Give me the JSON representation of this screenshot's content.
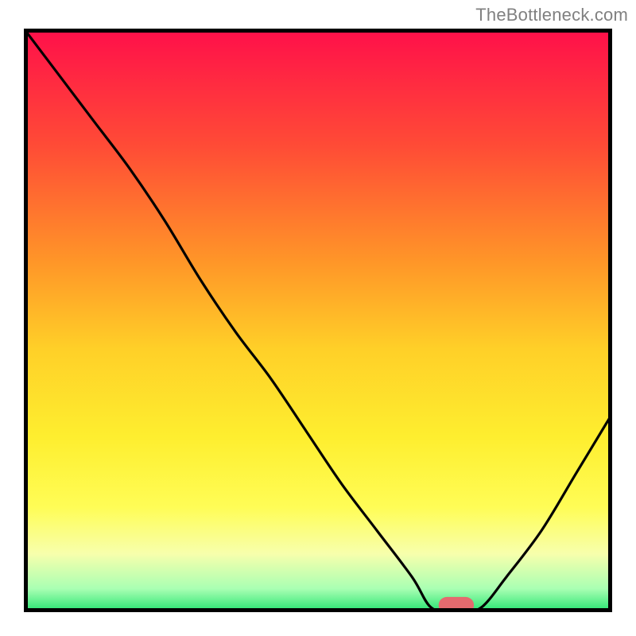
{
  "watermark": "TheBottleneck.com",
  "chart_data": {
    "type": "line",
    "title": "",
    "xlabel": "",
    "ylabel": "",
    "xlim": [
      0,
      100
    ],
    "ylim": [
      0,
      100
    ],
    "grid": false,
    "legend": false,
    "background_gradient": {
      "stops": [
        {
          "offset": 0.0,
          "color": "#ff0f4a"
        },
        {
          "offset": 0.2,
          "color": "#ff4b36"
        },
        {
          "offset": 0.4,
          "color": "#ff9628"
        },
        {
          "offset": 0.55,
          "color": "#ffd028"
        },
        {
          "offset": 0.7,
          "color": "#feee2f"
        },
        {
          "offset": 0.82,
          "color": "#fffd56"
        },
        {
          "offset": 0.9,
          "color": "#f7ffac"
        },
        {
          "offset": 0.96,
          "color": "#a9ffb3"
        },
        {
          "offset": 1.0,
          "color": "#23e36f"
        }
      ]
    },
    "series": [
      {
        "name": "bottleneck-curve",
        "x": [
          0,
          6,
          12,
          18,
          24,
          30,
          36,
          42,
          48,
          54,
          60,
          66,
          69,
          72,
          75,
          78,
          82,
          88,
          94,
          100
        ],
        "y": [
          100,
          92,
          84,
          76,
          67,
          57,
          48,
          40,
          31,
          22,
          14,
          6,
          1,
          0,
          0,
          1,
          6,
          14,
          24,
          34
        ]
      }
    ],
    "marker": {
      "name": "optimal-range",
      "x_center": 73.5,
      "y": 1.2,
      "rx": 3.0,
      "ry": 1.4,
      "color": "#e46a6e"
    },
    "frame": {
      "color": "#000000",
      "width": 5
    }
  }
}
